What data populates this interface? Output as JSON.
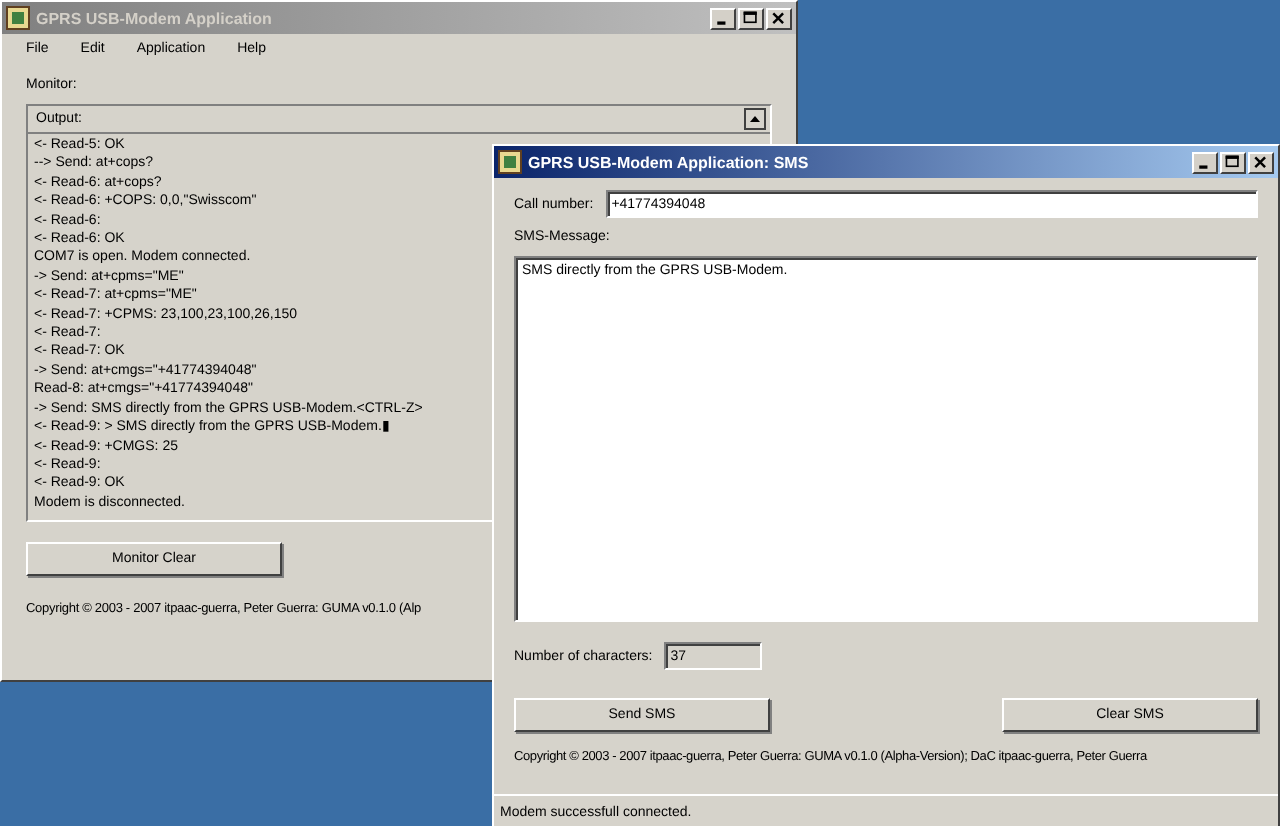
{
  "main_window": {
    "title": "GPRS USB-Modem Application",
    "active": false,
    "menu": [
      "File",
      "Edit",
      "Application",
      "Help"
    ],
    "monitor_label": "Monitor:",
    "output": {
      "title": "Output:",
      "lines": [
        "<- Read-5: OK",
        "--> Send: at+cops?",
        "<- Read-6: at+cops?",
        "<- Read-6: +COPS: 0,0,\"Swisscom\"",
        "<- Read-6:",
        "<- Read-6: OK",
        "COM7 is open. Modem connected.",
        "-> Send: at+cpms=\"ME\"",
        "<- Read-7: at+cpms=\"ME\"",
        "<- Read-7: +CPMS: 23,100,23,100,26,150",
        "<- Read-7:",
        "<- Read-7: OK",
        "-> Send: at+cmgs=\"+41774394048\"",
        "Read-8: at+cmgs=\"+41774394048\"",
        "-> Send: SMS directly from the GPRS USB-Modem.<CTRL-Z>",
        "<- Read-9: > SMS directly from the GPRS USB-Modem.▮",
        "<- Read-9: +CMGS: 25",
        "<- Read-9:",
        "<- Read-9: OK",
        "Modem is disconnected."
      ]
    },
    "clear_button": "Monitor Clear",
    "copyright": "Copyright © 2003 - 2007 itpaac-guerra, Peter Guerra: GUMA v0.1.0 (Alp"
  },
  "sms_window": {
    "title": "GPRS USB-Modem Application: SMS",
    "active": true,
    "call_number_label": "Call number:",
    "call_number": "+41774394048",
    "message_label": "SMS-Message:",
    "message": "SMS directly from the GPRS USB-Modem.",
    "char_count_label": "Number of characters:",
    "char_count": "37",
    "buttons": [
      "Send SMS",
      "Clear SMS"
    ],
    "copyright": "Copyright © 2003 - 2007 itpaac-guerra, Peter Guerra: GUMA v0.1.0 (Alpha-Version); DaC itpaac-guerra, Peter Guerra",
    "status_bar": "Modem successfull connected."
  }
}
